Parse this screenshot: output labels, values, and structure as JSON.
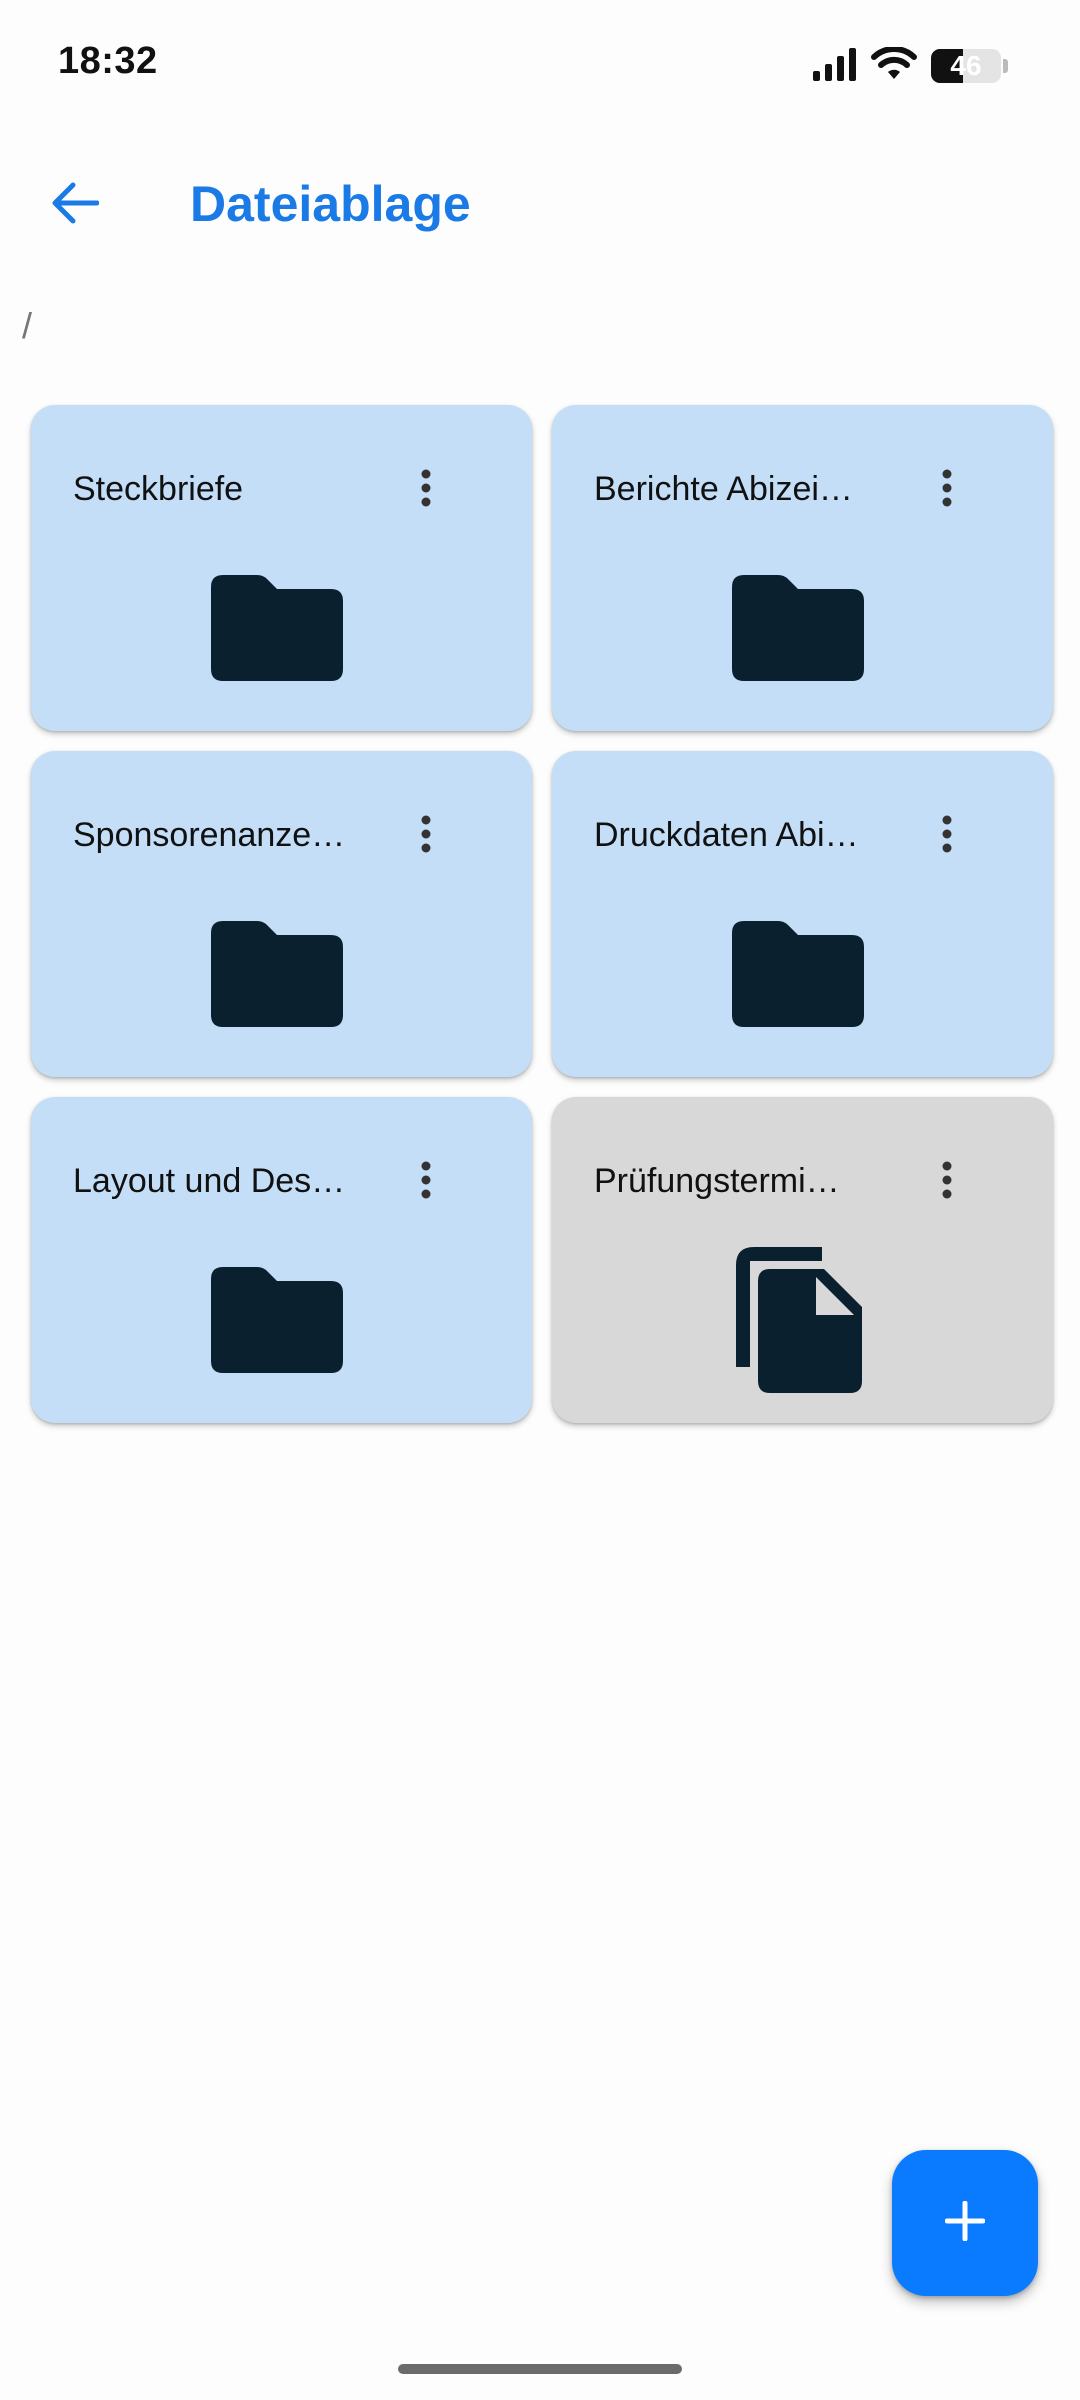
{
  "status_bar": {
    "time": "18:32",
    "battery_level": "46",
    "battery_fraction": 0.46
  },
  "app_bar": {
    "title": "Dateiablage",
    "back_icon": "arrow-back-icon"
  },
  "breadcrumb": "/",
  "items": [
    {
      "name": "Steckbriefe",
      "type": "folder",
      "icon": "folder-icon"
    },
    {
      "name": "Berichte Abizei…",
      "type": "folder",
      "icon": "folder-icon"
    },
    {
      "name": "Sponsorenanze…",
      "type": "folder",
      "icon": "folder-icon"
    },
    {
      "name": "Druckdaten Abi…",
      "type": "folder",
      "icon": "folder-icon"
    },
    {
      "name": "Layout und Des…",
      "type": "folder",
      "icon": "folder-icon"
    },
    {
      "name": "Prüfungstermi…",
      "type": "file",
      "icon": "file-copy-icon"
    }
  ],
  "fab": {
    "icon": "plus-icon"
  },
  "colors": {
    "accent": "#1a7ae6",
    "fab": "#0a7bff",
    "folder_card": "#c4def8",
    "file_card": "#d8d8d8",
    "icon_dark": "#0b202f"
  }
}
